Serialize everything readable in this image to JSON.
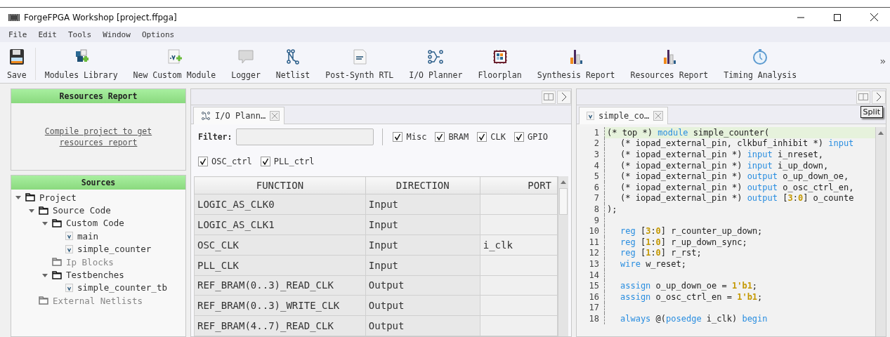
{
  "window": {
    "title": "ForgeFPGA Workshop [project.ffpga]"
  },
  "menu": [
    "File",
    "Edit",
    "Tools",
    "Window",
    "Options"
  ],
  "toolbar": [
    {
      "label": "Save"
    },
    {
      "label": "Modules Library"
    },
    {
      "label": "New Custom Module"
    },
    {
      "label": "Logger",
      "disabled": true
    },
    {
      "label": "Netlist"
    },
    {
      "label": "Post-Synth RTL"
    },
    {
      "label": "I/O Planner"
    },
    {
      "label": "Floorplan"
    },
    {
      "label": "Synthesis Report"
    },
    {
      "label": "Resources Report"
    },
    {
      "label": "Timing Analysis"
    }
  ],
  "toolbar_overflow": "»",
  "resources_panel": {
    "title": "Resources Report",
    "link": "Compile project to get resources report"
  },
  "sources_panel": {
    "title": "Sources",
    "tree": [
      {
        "label": "Project",
        "kind": "folder",
        "expanded": true,
        "disabled": false,
        "children": [
          {
            "label": "Source Code",
            "kind": "folder",
            "expanded": true,
            "disabled": false,
            "children": [
              {
                "label": "Custom Code",
                "kind": "folder",
                "expanded": true,
                "disabled": false,
                "children": [
                  {
                    "label": "main",
                    "kind": "file",
                    "disabled": false
                  },
                  {
                    "label": "simple_counter",
                    "kind": "file",
                    "disabled": false
                  }
                ]
              },
              {
                "label": "Ip Blocks",
                "kind": "folder",
                "expanded": false,
                "disabled": true
              },
              {
                "label": "Testbenches",
                "kind": "folder",
                "expanded": true,
                "disabled": false,
                "children": [
                  {
                    "label": "simple_counter_tb",
                    "kind": "file",
                    "disabled": false
                  }
                ]
              }
            ]
          },
          {
            "label": "External Netlists",
            "kind": "folder",
            "expanded": false,
            "disabled": true
          }
        ]
      }
    ]
  },
  "io_panel": {
    "tab": "I/O Plann…",
    "filter_label": "Filter:",
    "checkboxes": [
      {
        "label": "Misc",
        "checked": true
      },
      {
        "label": "BRAM",
        "checked": true
      },
      {
        "label": "CLK",
        "checked": true
      },
      {
        "label": "GPIO",
        "checked": true
      },
      {
        "label": "OSC_ctrl",
        "checked": true
      },
      {
        "label": "PLL_ctrl",
        "checked": true
      }
    ],
    "columns": [
      "FUNCTION",
      "DIRECTION",
      "PORT"
    ],
    "rows": [
      [
        "LOGIC_AS_CLK0",
        "Input",
        null
      ],
      [
        "LOGIC_AS_CLK1",
        "Input",
        null
      ],
      [
        "OSC_CLK",
        "Input",
        "i_clk"
      ],
      [
        "PLL_CLK",
        "Input",
        null
      ],
      [
        "REF_BRAM(0..3)_READ_CLK",
        "Output",
        null
      ],
      [
        "REF_BRAM(0..3)_WRITE_CLK",
        "Output",
        null
      ],
      [
        "REF_BRAM(4..7)_READ_CLK",
        "Output",
        null
      ]
    ]
  },
  "editor_panel": {
    "tab": "simple_co…",
    "tooltip": "Split",
    "lines": [
      {
        "number": "1",
        "current": true,
        "indented": false,
        "tokens": [
          {
            "kind": "t",
            "text": "(* top *) "
          },
          {
            "kind": "k",
            "text": "module"
          },
          {
            "kind": "t",
            "text": " simple_counter("
          }
        ]
      },
      {
        "number": "2",
        "current": false,
        "indented": true,
        "tokens": [
          {
            "kind": "t",
            "text": "(* iopad_external_pin, clkbuf_inhibit *) "
          },
          {
            "kind": "k",
            "text": "input"
          }
        ]
      },
      {
        "number": "3",
        "current": false,
        "indented": true,
        "tokens": [
          {
            "kind": "t",
            "text": "(* iopad_external_pin *) "
          },
          {
            "kind": "k",
            "text": "input"
          },
          {
            "kind": "t",
            "text": " i_nreset,"
          }
        ]
      },
      {
        "number": "4",
        "current": false,
        "indented": true,
        "tokens": [
          {
            "kind": "t",
            "text": "(* iopad_external_pin *) "
          },
          {
            "kind": "k",
            "text": "input"
          },
          {
            "kind": "t",
            "text": " i_up_down,"
          }
        ]
      },
      {
        "number": "5",
        "current": false,
        "indented": true,
        "tokens": [
          {
            "kind": "t",
            "text": "(* iopad_external_pin *) "
          },
          {
            "kind": "k",
            "text": "output"
          },
          {
            "kind": "t",
            "text": " o_up_down_oe,"
          }
        ]
      },
      {
        "number": "6",
        "current": false,
        "indented": true,
        "tokens": [
          {
            "kind": "t",
            "text": "(* iopad_external_pin *) "
          },
          {
            "kind": "k",
            "text": "output"
          },
          {
            "kind": "t",
            "text": " o_osc_ctrl_en,"
          }
        ]
      },
      {
        "number": "7",
        "current": false,
        "indented": true,
        "tokens": [
          {
            "kind": "t",
            "text": "(* iopad_external_pin *) "
          },
          {
            "kind": "k",
            "text": "output"
          },
          {
            "kind": "t",
            "text": " ["
          },
          {
            "kind": "n",
            "text": "3"
          },
          {
            "kind": "t",
            "text": ":"
          },
          {
            "kind": "n",
            "text": "0"
          },
          {
            "kind": "t",
            "text": "] o_counte"
          }
        ]
      },
      {
        "number": "8",
        "current": false,
        "indented": false,
        "tokens": [
          {
            "kind": "t",
            "text": ");"
          }
        ]
      },
      {
        "number": "9",
        "current": false
      },
      {
        "number": "10",
        "current": false,
        "indented": true,
        "tokens": [
          {
            "kind": "k",
            "text": "reg"
          },
          {
            "kind": "t",
            "text": " ["
          },
          {
            "kind": "n",
            "text": "3"
          },
          {
            "kind": "t",
            "text": ":"
          },
          {
            "kind": "n",
            "text": "0"
          },
          {
            "kind": "t",
            "text": "] r_counter_up_down;"
          }
        ]
      },
      {
        "number": "11",
        "current": false,
        "indented": true,
        "tokens": [
          {
            "kind": "k",
            "text": "reg"
          },
          {
            "kind": "t",
            "text": " ["
          },
          {
            "kind": "n",
            "text": "1"
          },
          {
            "kind": "t",
            "text": ":"
          },
          {
            "kind": "n",
            "text": "0"
          },
          {
            "kind": "t",
            "text": "] r_up_down_sync;"
          }
        ]
      },
      {
        "number": "12",
        "current": false,
        "indented": true,
        "tokens": [
          {
            "kind": "k",
            "text": "reg"
          },
          {
            "kind": "t",
            "text": " ["
          },
          {
            "kind": "n",
            "text": "1"
          },
          {
            "kind": "t",
            "text": ":"
          },
          {
            "kind": "n",
            "text": "0"
          },
          {
            "kind": "t",
            "text": "] r_rst;"
          }
        ]
      },
      {
        "number": "13",
        "current": false,
        "indented": true,
        "tokens": [
          {
            "kind": "k",
            "text": "wire"
          },
          {
            "kind": "t",
            "text": " w_reset;"
          }
        ]
      },
      {
        "number": "14",
        "current": false
      },
      {
        "number": "15",
        "current": false,
        "indented": true,
        "tokens": [
          {
            "kind": "k",
            "text": "assign"
          },
          {
            "kind": "t",
            "text": " o_up_down_oe = "
          },
          {
            "kind": "n",
            "text": "1'b1"
          },
          {
            "kind": "t",
            "text": ";"
          }
        ]
      },
      {
        "number": "16",
        "current": false,
        "indented": true,
        "tokens": [
          {
            "kind": "k",
            "text": "assign"
          },
          {
            "kind": "t",
            "text": " o_osc_ctrl_en = "
          },
          {
            "kind": "n",
            "text": "1'b1"
          },
          {
            "kind": "t",
            "text": ";"
          }
        ]
      },
      {
        "number": "17",
        "current": false
      },
      {
        "number": "18",
        "current": false,
        "indented": true,
        "tokens": [
          {
            "kind": "k",
            "text": "always"
          },
          {
            "kind": "t",
            "text": " @("
          },
          {
            "kind": "k",
            "text": "posedge"
          },
          {
            "kind": "t",
            "text": " i_clk) "
          },
          {
            "kind": "k",
            "text": "begin"
          }
        ]
      }
    ]
  }
}
